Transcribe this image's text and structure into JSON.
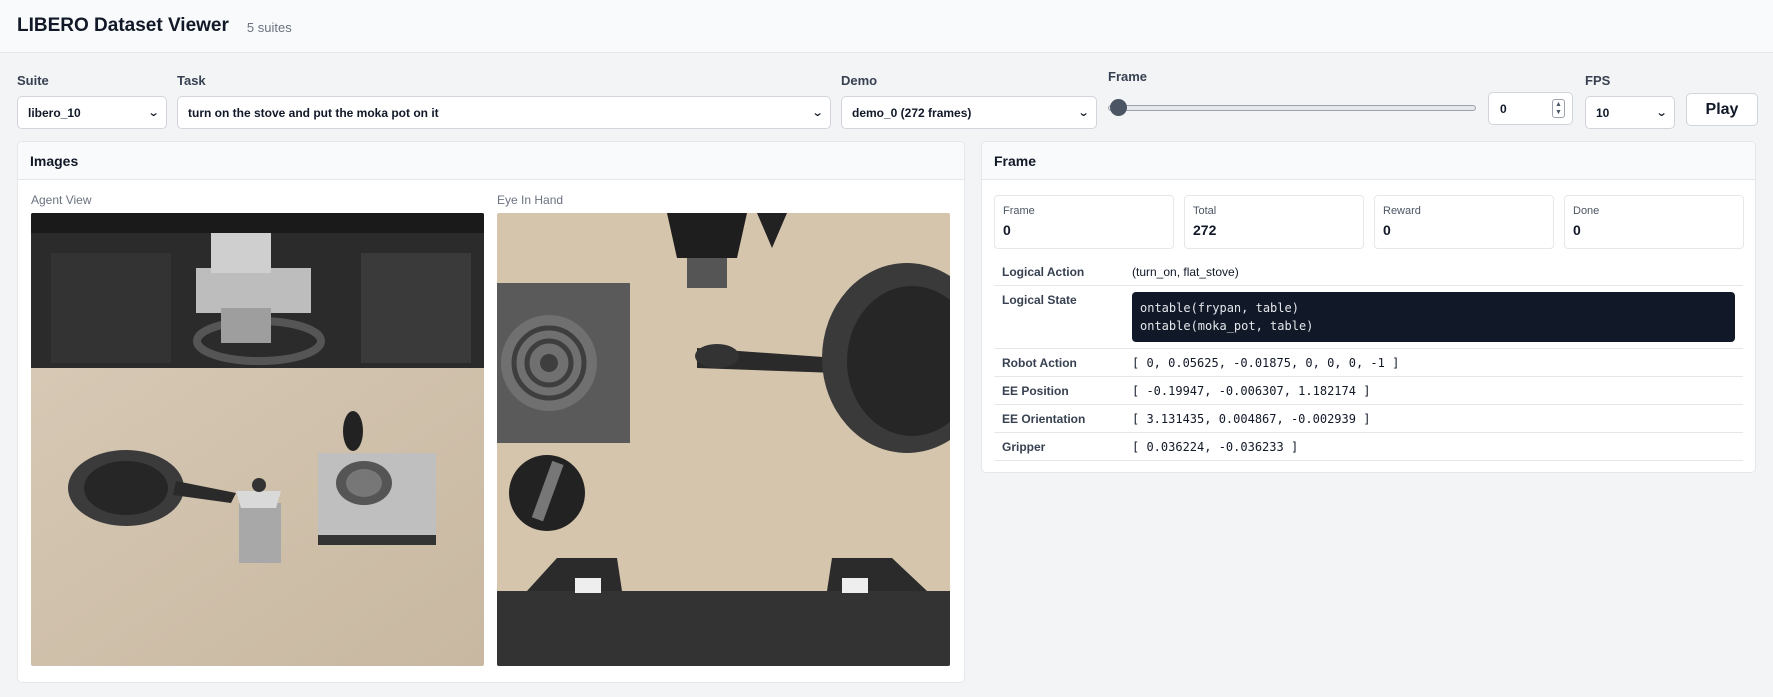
{
  "header": {
    "title": "LIBERO Dataset Viewer",
    "suite_count": "5 suites"
  },
  "controls": {
    "suite": {
      "label": "Suite",
      "value": "libero_10"
    },
    "task": {
      "label": "Task",
      "value": "turn on the stove and put the moka pot on it"
    },
    "demo": {
      "label": "Demo",
      "value": "demo_0 (272 frames)"
    },
    "frame": {
      "label": "Frame",
      "value": "0",
      "slider_fraction": 0
    },
    "fps": {
      "label": "FPS",
      "value": "10"
    },
    "play_label": "Play"
  },
  "images": {
    "title": "Images",
    "agent_view_label": "Agent View",
    "eye_in_hand_label": "Eye In Hand"
  },
  "frame_panel": {
    "title": "Frame",
    "stats": [
      {
        "label": "Frame",
        "value": "0"
      },
      {
        "label": "Total",
        "value": "272"
      },
      {
        "label": "Reward",
        "value": "0"
      },
      {
        "label": "Done",
        "value": "0"
      }
    ],
    "logical_action": {
      "label": "Logical Action",
      "value": "(turn_on, flat_stove)"
    },
    "logical_state": {
      "label": "Logical State",
      "lines": [
        "ontable(frypan, table)",
        "ontable(moka_pot, table)"
      ]
    },
    "robot_action": {
      "label": "Robot Action",
      "value": "[ 0, 0.05625, -0.01875, 0, 0, 0, -1 ]"
    },
    "ee_position": {
      "label": "EE Position",
      "value": "[ -0.19947, -0.006307, 1.182174 ]"
    },
    "ee_orientation": {
      "label": "EE Orientation",
      "value": "[ 3.131435, 0.004867, -0.002939 ]"
    },
    "gripper": {
      "label": "Gripper",
      "value": "[ 0.036224, -0.036233 ]"
    }
  },
  "colors": {
    "code_bg": "#111827",
    "accent_thumb": "#4b5563"
  }
}
